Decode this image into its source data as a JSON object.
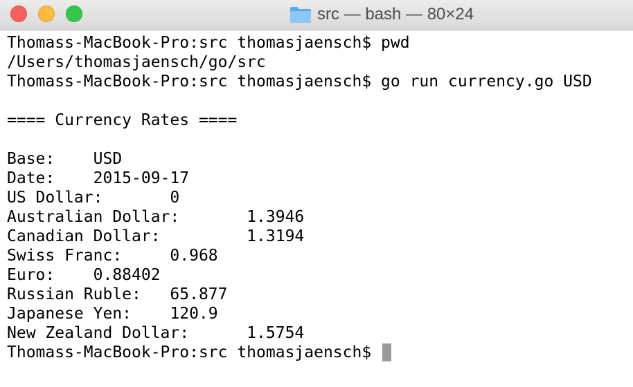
{
  "window": {
    "title": "src — bash — 80×24",
    "buttons": {
      "close": "close",
      "minimize": "minimize",
      "zoom": "zoom"
    },
    "title_icon": "folder-icon",
    "colors": {
      "close": "#fc605c",
      "minimize": "#fdbc40",
      "zoom": "#34c84a",
      "folder": "#6fb6f0",
      "cursor": "#9a9a9a"
    }
  },
  "terminal": {
    "lines": [
      "Thomass-MacBook-Pro:src thomasjaensch$ pwd",
      "/Users/thomasjaensch/go/src",
      "Thomass-MacBook-Pro:src thomasjaensch$ go run currency.go USD",
      "",
      "==== Currency Rates ====",
      "",
      "Base:    USD",
      "Date:    2015-09-17",
      "US Dollar:       0",
      "Australian Dollar:       1.3946",
      "Canadian Dollar:         1.3194",
      "Swiss Franc:     0.968",
      "Euro:    0.88402",
      "Russian Ruble:   65.877",
      "Japanese Yen:    120.9",
      "New Zealand Dollar:      1.5754"
    ],
    "prompt": "Thomass-MacBook-Pro:src thomasjaensch$ "
  }
}
